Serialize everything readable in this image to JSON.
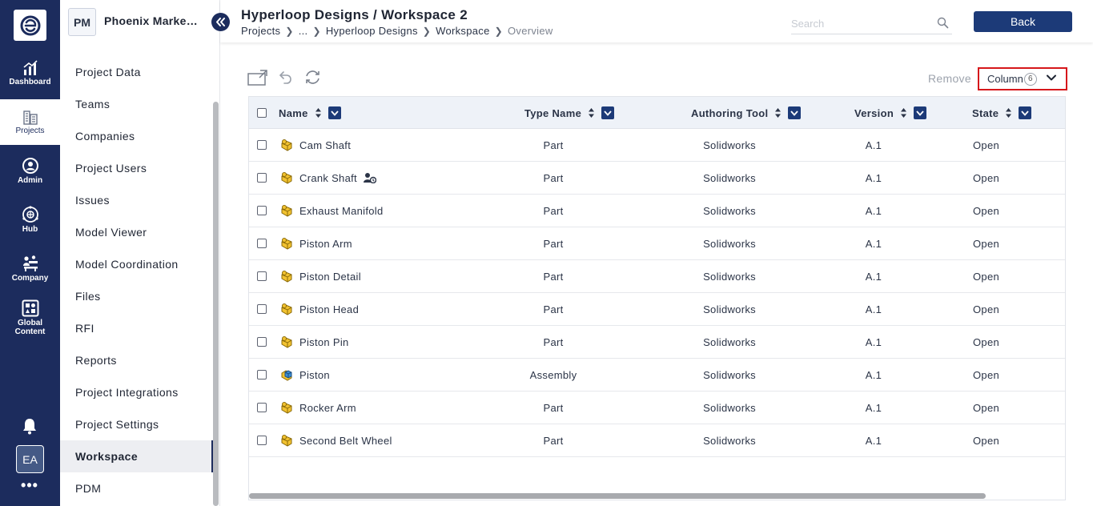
{
  "nav_rail": {
    "items": [
      {
        "label": "Dashboard",
        "icon": "dashboard-chart-icon"
      },
      {
        "label": "Projects",
        "icon": "building-icon"
      },
      {
        "label": "Admin",
        "icon": "admin-user-icon"
      },
      {
        "label": "Hub",
        "icon": "hub-globe-icon"
      },
      {
        "label": "Company",
        "icon": "company-people-icon"
      },
      {
        "label": "Global\nContent",
        "icon": "global-content-icon"
      }
    ],
    "user_initials": "EA",
    "more": "•••"
  },
  "project": {
    "initials": "PM",
    "name": "Phoenix Marketing"
  },
  "sidebar": {
    "items": [
      {
        "label": "Project Data"
      },
      {
        "label": "Teams"
      },
      {
        "label": "Companies"
      },
      {
        "label": "Project Users"
      },
      {
        "label": "Issues"
      },
      {
        "label": "Model Viewer"
      },
      {
        "label": "Model Coordination"
      },
      {
        "label": "Files"
      },
      {
        "label": "RFI"
      },
      {
        "label": "Reports"
      },
      {
        "label": "Project Integrations"
      },
      {
        "label": "Project Settings"
      },
      {
        "label": "Workspace"
      },
      {
        "label": "PDM"
      }
    ]
  },
  "header": {
    "title": "Hyperloop Designs / Workspace 2",
    "breadcrumb": [
      "Projects",
      "...",
      "Hyperloop Designs",
      "Workspace",
      "Overview"
    ],
    "search_placeholder": "Search",
    "back_label": "Back"
  },
  "toolbar": {
    "remove_label": "Remove",
    "column_label": "Column",
    "column_count": "6"
  },
  "table": {
    "columns": [
      "Name",
      "Type Name",
      "Authoring Tool",
      "Version",
      "State"
    ],
    "rows": [
      {
        "name": "Cam Shaft",
        "type": "Part",
        "tool": "Solidworks",
        "version": "A.1",
        "state": "Open",
        "icon": "part-icon"
      },
      {
        "name": "Crank Shaft",
        "type": "Part",
        "tool": "Solidworks",
        "version": "A.1",
        "state": "Open",
        "icon": "part-icon",
        "extra_icon": "user-lock-icon"
      },
      {
        "name": "Exhaust Manifold",
        "type": "Part",
        "tool": "Solidworks",
        "version": "A.1",
        "state": "Open",
        "icon": "part-icon"
      },
      {
        "name": "Piston Arm",
        "type": "Part",
        "tool": "Solidworks",
        "version": "A.1",
        "state": "Open",
        "icon": "part-icon"
      },
      {
        "name": "Piston Detail",
        "type": "Part",
        "tool": "Solidworks",
        "version": "A.1",
        "state": "Open",
        "icon": "part-icon"
      },
      {
        "name": "Piston Head",
        "type": "Part",
        "tool": "Solidworks",
        "version": "A.1",
        "state": "Open",
        "icon": "part-icon"
      },
      {
        "name": "Piston Pin",
        "type": "Part",
        "tool": "Solidworks",
        "version": "A.1",
        "state": "Open",
        "icon": "part-icon"
      },
      {
        "name": "Piston",
        "type": "Assembly",
        "tool": "Solidworks",
        "version": "A.1",
        "state": "Open",
        "icon": "assembly-icon"
      },
      {
        "name": "Rocker Arm",
        "type": "Part",
        "tool": "Solidworks",
        "version": "A.1",
        "state": "Open",
        "icon": "part-icon"
      },
      {
        "name": "Second Belt Wheel",
        "type": "Part",
        "tool": "Solidworks",
        "version": "A.1",
        "state": "Open",
        "icon": "part-icon"
      }
    ]
  },
  "colors": {
    "rail_bg": "#1c2c5d",
    "accent": "#1c3a78",
    "highlight_border": "#d6171b",
    "part_yellow": "#f2c230",
    "assembly_blue": "#3d8fd6"
  }
}
